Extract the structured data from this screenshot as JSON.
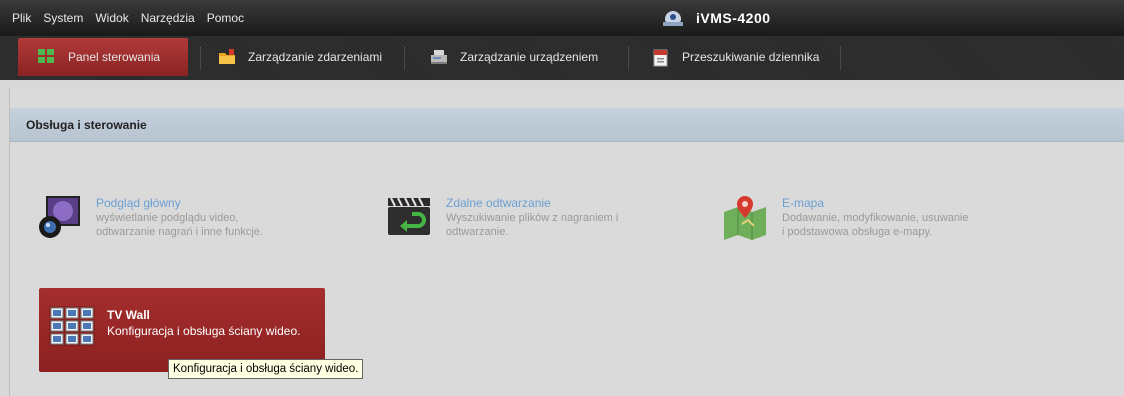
{
  "menu": {
    "items": [
      "Plik",
      "System",
      "Widok",
      "Narzędzia",
      "Pomoc"
    ]
  },
  "app": {
    "title": "iVMS-4200"
  },
  "tabs": [
    {
      "label": "Panel sterowania",
      "icon": "panel-grid-icon",
      "active": true
    },
    {
      "label": "Zarządzanie zdarzeniami",
      "icon": "event-folder-icon",
      "active": false
    },
    {
      "label": "Zarządzanie urządzeniem",
      "icon": "device-icon",
      "active": false
    },
    {
      "label": "Przeszukiwanie dziennika",
      "icon": "log-search-icon",
      "active": false
    }
  ],
  "section": {
    "title": "Obsługa i sterowanie"
  },
  "modules": [
    {
      "title": "Podgląd główny",
      "desc1": "wyświetlanie podglądu video,",
      "desc2": "odtwarzanie nagrań i inne funkcje.",
      "icon": "camera-monitor-icon"
    },
    {
      "title": "Zdalne odtwarzanie",
      "desc1": "Wyszukiwanie plików z nagraniem i",
      "desc2": "odtwarzanie.",
      "icon": "clapperboard-playback-icon"
    },
    {
      "title": "E-mapa",
      "desc1": "Dodawanie, modyfikowanie, usuwanie",
      "desc2": "i podstawowa obsługa e-mapy.",
      "icon": "map-pin-icon"
    }
  ],
  "tvwall": {
    "title": "TV Wall",
    "desc": "Konfiguracja i obsługa ściany wideo.",
    "icon": "tv-wall-grid-icon"
  },
  "tooltip": {
    "text": "Konfiguracja i obsługa ściany wideo."
  },
  "colors": {
    "active_tab": "#9e2c2c",
    "tvwall_bg": "#9a2727",
    "link_blue": "#6a9fd1",
    "section_bg": "#bdc9d5"
  }
}
